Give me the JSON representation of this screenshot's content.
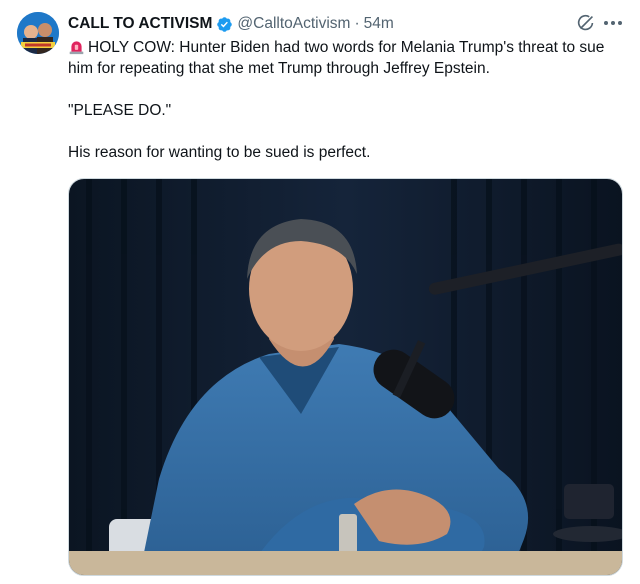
{
  "author": {
    "display_name": "CALL TO ACTIVISM",
    "handle": "@CalltoActivism",
    "timestamp": "54m",
    "verified": true
  },
  "tweet": {
    "line1": "HOLY COW: Hunter Biden had two words for Melania Trump's threat to sue him for repeating that she met Trump through Jeffrey Epstein.",
    "line2": "\"PLEASE DO.\"",
    "line3": "His reason for wanting to be sued is perfect."
  },
  "icons": {
    "siren": "rotating-light-emoji",
    "verified": "verified-badge-icon",
    "grok": "grok-icon",
    "more": "more-options-icon"
  },
  "colors": {
    "verified_blue": "#1d9bf0",
    "secondary_text": "#536471",
    "primary_text": "#0f1419"
  }
}
